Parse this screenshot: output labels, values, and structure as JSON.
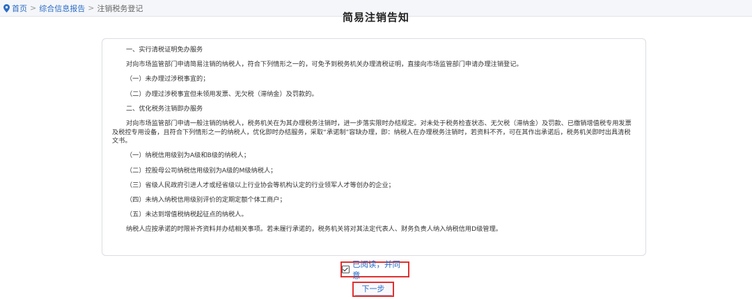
{
  "breadcrumb": {
    "home": "首页",
    "section": "综合信息报告",
    "current": "注销税务登记",
    "sep": ">"
  },
  "title": "简易注销告知",
  "notice": {
    "h1": "一、实行清税证明免办服务",
    "p1": "对向市场监管部门申请简易注销的纳税人，符合下列情形之一的，可免予到税务机关办理清税证明，直接向市场监管部门申请办理注销登记。",
    "i1": "（一）未办理过涉税事宜的；",
    "i2": "（二）办理过涉税事宜但未领用发票、无欠税（滞纳金）及罚款的。",
    "h2": "二、优化税务注销即办服务",
    "p2": "对向市场监管部门申请一般注销的纳税人，税务机关在为其办理税务注销时，进一步落实限时办结规定。对未处于税务检查状态、无欠税（滞纳金）及罚款、已缴销增值税专用发票及税控专用设备，且符合下列情形之一的纳税人，优化即时办结服务，采取“承诺制”容缺办理，即：纳税人在办理税务注销时，若资料不齐，可在其作出承诺后，税务机关即时出具清税文书。",
    "j1": "（一）纳税信用级别为A级和B级的纳税人；",
    "j2": "（二）控股母公司纳税信用级别为A级的M级纳税人；",
    "j3": "（三）省级人民政府引进人才或经省级以上行业协会等机构认定的行业领军人才等创办的企业；",
    "j4": "（四）未纳入纳税信用级别评价的定期定额个体工商户；",
    "j5": "（五）未达到增值税纳税起征点的纳税人。",
    "p3": "纳税人应按承诺的时限补齐资料并办结相关事项。若未履行承诺的，税务机关将对其法定代表人、财务负责人纳入纳税信用D级管理。"
  },
  "agree_label": "已阅读，并同意",
  "agree_checked": true,
  "next_label": "下一步",
  "colors": {
    "link": "#2b6cc4",
    "highlight_border": "#e03030"
  }
}
